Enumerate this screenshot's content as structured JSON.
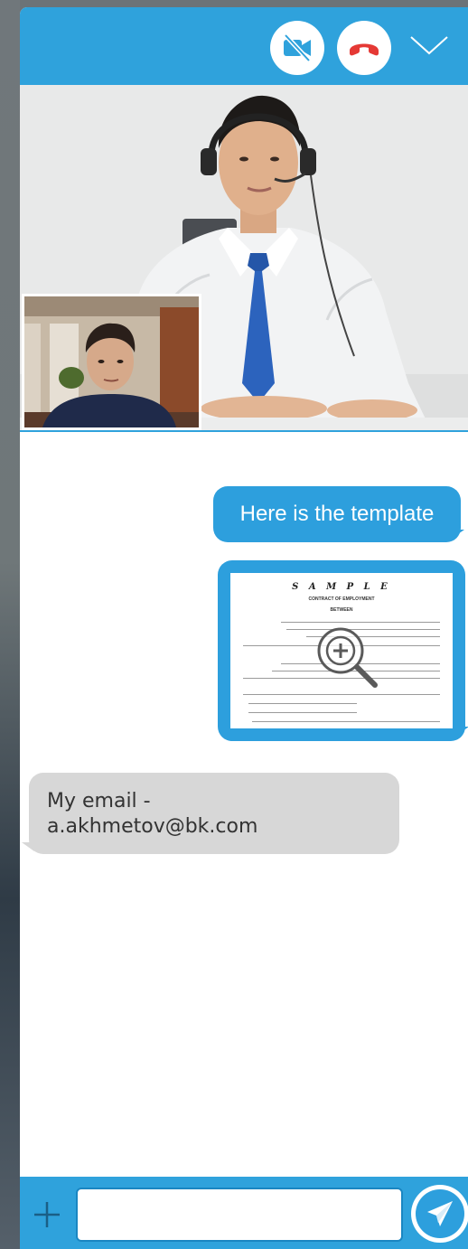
{
  "header": {
    "video_toggle_icon": "video-off-icon",
    "hangup_icon": "phone-hangup-icon",
    "collapse_icon": "chevron-down-icon",
    "accent_color": "#2fa2dc",
    "hangup_color": "#e53935"
  },
  "messages": [
    {
      "direction": "outgoing",
      "type": "text",
      "text": "Here is the template"
    },
    {
      "direction": "outgoing",
      "type": "attachment",
      "icon": "zoom-in-icon",
      "document": {
        "title": "S A M P L E",
        "subtitle": "CONTRACT OF EMPLOYMENT",
        "heading": "BETWEEN"
      }
    },
    {
      "direction": "incoming",
      "type": "text",
      "lines": [
        "My email -",
        "a.akhmetov@bk.com"
      ]
    }
  ],
  "composer": {
    "input_value": "",
    "input_placeholder": "",
    "attach_icon": "plus-icon",
    "send_icon": "send-icon"
  },
  "colors": {
    "outgoing_bubble": "#2d9fdd",
    "incoming_bubble": "#d7d7d7"
  }
}
